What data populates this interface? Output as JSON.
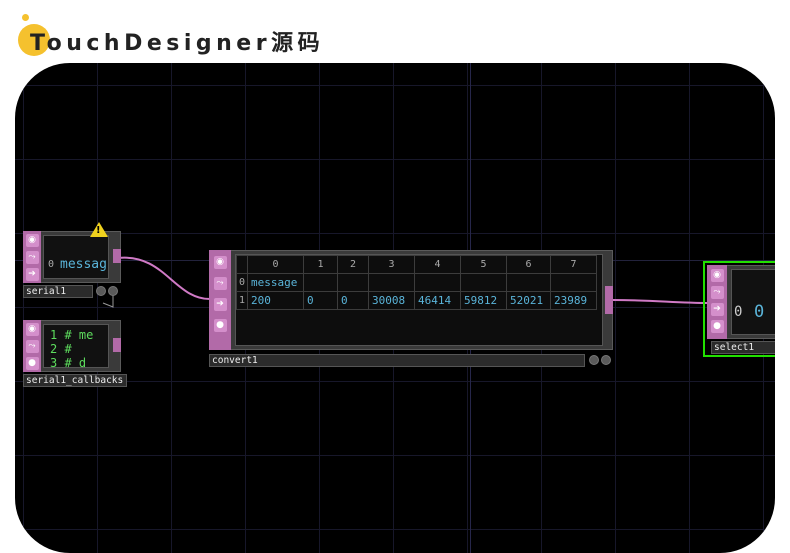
{
  "header": {
    "title": "TouchDesigner源码"
  },
  "nodes": {
    "serial": {
      "name": "serial1",
      "row_index": "0",
      "row_value": "messag"
    },
    "callbacks": {
      "name": "serial1_callbacks",
      "lines": [
        "1 # me",
        "2 #",
        "3 # d"
      ]
    },
    "convert": {
      "name": "convert1",
      "columns": [
        "0",
        "1",
        "2",
        "3",
        "4",
        "5",
        "6",
        "7"
      ],
      "rows": [
        {
          "index": "0",
          "cells": [
            "message",
            "",
            "",
            "",
            "",
            "",
            "",
            ""
          ]
        },
        {
          "index": "1",
          "cells": [
            "200",
            "0",
            "0",
            "30008",
            "46414",
            "59812",
            "52021",
            "23989"
          ]
        }
      ]
    },
    "select": {
      "name": "select1",
      "row_index": "0",
      "row_value": "0"
    }
  },
  "icons": [
    "viewer-toggle-icon",
    "bypass-icon",
    "pass-through-icon",
    "lock-icon",
    "warning-icon"
  ],
  "colors": {
    "canvas_bg": "#000000",
    "dat_node": "#b26aa8",
    "wire": "#d07ac6",
    "selected_border": "#22e000",
    "text_cyan": "#5ab4d9",
    "header_accent": "#f5c12e"
  }
}
